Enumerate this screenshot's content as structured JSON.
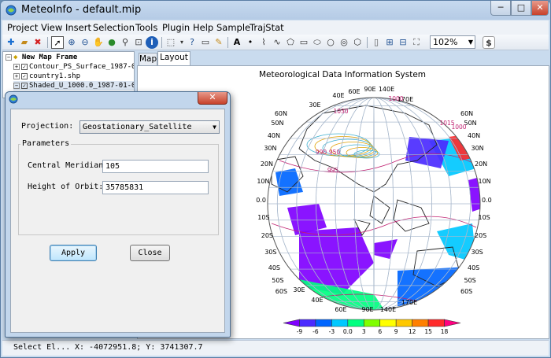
{
  "window": {
    "title": "MeteoInfo - default.mip",
    "min_label": "─",
    "max_label": "□",
    "close_label": "✕"
  },
  "menu": [
    "Project",
    "View",
    "Insert",
    "Selection",
    "Tools",
    "Plugin",
    "Help",
    "Sample",
    "TrajStat"
  ],
  "toolbar": {
    "icons": [
      "add-layer-icon",
      "open-icon",
      "remove-layer-icon",
      "select-icon",
      "zoom-in-icon",
      "zoom-out-icon",
      "pan-icon",
      "full-extent-icon",
      "zoom-layer-icon",
      "zoom-select-icon",
      "identify-icon",
      "select-box-icon",
      "help-icon",
      "measure-icon",
      "edit-icon",
      "text-icon",
      "point-icon",
      "polyline-icon",
      "curve-icon",
      "polygon-icon",
      "rectangle-icon",
      "ellipse-icon",
      "circle-icon",
      "freehand-icon",
      "page-icon",
      "page-zoom-in-icon",
      "page-zoom-out-icon",
      "page-fit-icon",
      "run-script-icon"
    ],
    "zoom_value": "102%"
  },
  "layers": {
    "root": "New Map Frame",
    "items": [
      "Contour_PS_Surface_1987-01-",
      "country1.shp",
      "Shaded_U_1000.0_1987-01-01"
    ]
  },
  "tabs": [
    "Map",
    "Layout"
  ],
  "map": {
    "title": "Meteorological Data Information System",
    "lon_labels_top": [
      "90E",
      "140E",
      "60E",
      "40E",
      "30E",
      "170E"
    ],
    "lon_labels_bottom": [
      "60E",
      "90E",
      "140E",
      "170E",
      "40E",
      "30E"
    ],
    "lat_labels_left": [
      "60N",
      "50N",
      "40N",
      "30N",
      "20N",
      "10N",
      "0.0",
      "10S",
      "20S",
      "30S",
      "40S",
      "50S",
      "60S"
    ],
    "lat_labels_right": [
      "60N",
      "50N",
      "40N",
      "30N",
      "20N",
      "10N",
      "0.0",
      "10S",
      "20S",
      "30S",
      "40S",
      "50S",
      "60S"
    ],
    "contour_labels": [
      "1000",
      "1015",
      "1000",
      "990",
      "995",
      "1030",
      "950"
    ],
    "legend_values": [
      "-9",
      "-6",
      "-3",
      "0.0",
      "3",
      "6",
      "9",
      "12",
      "15",
      "18"
    ],
    "legend_colors": [
      "#8000ff",
      "#4b2bff",
      "#0066ff",
      "#00c8ff",
      "#00ff80",
      "#7fff00",
      "#ffff00",
      "#ffc800",
      "#ff8000",
      "#ff2b2b",
      "#ff0080"
    ]
  },
  "status": {
    "mode": "Select El...",
    "coords": "X: -4072951.8; Y: 3741307.7"
  },
  "dialog": {
    "close_label": "✕",
    "projection_label": "Projection:",
    "projection_value": "Geostationary_Satellite",
    "params_label": "Parameters",
    "central_meridian_label": "Central Meridian:",
    "central_meridian_value": "105",
    "height_label": "Height of Orbit:",
    "height_value": "35785831",
    "apply_label": "Apply",
    "close_button_label": "Close"
  }
}
